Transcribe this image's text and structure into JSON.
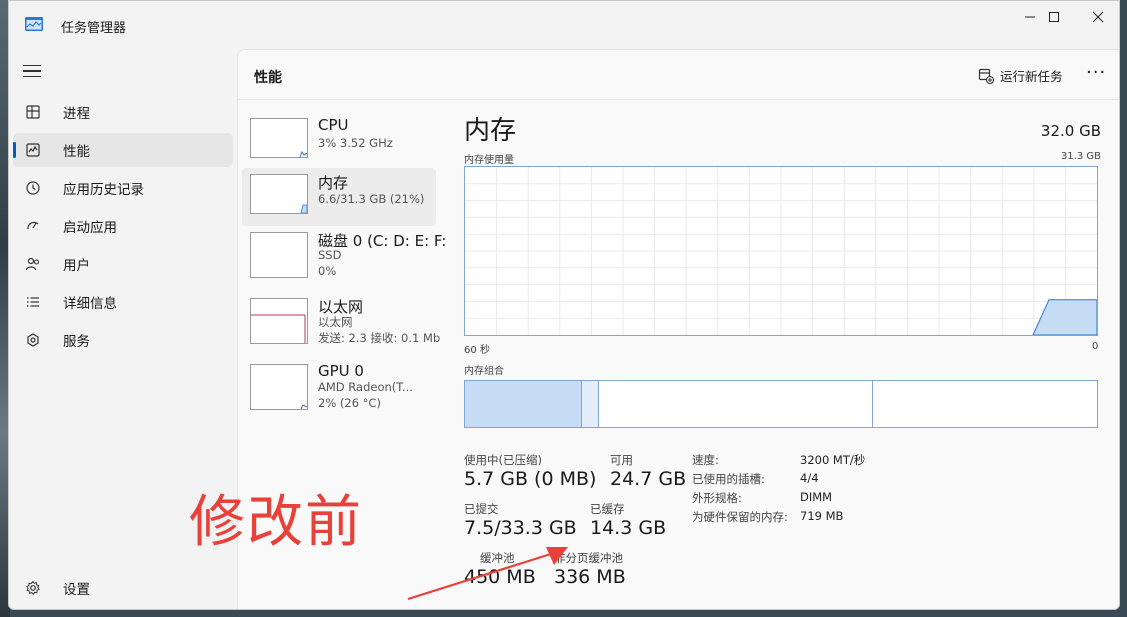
{
  "window": {
    "title": "任务管理器",
    "minimize_glyph": "—",
    "maximize_glyph": "☐",
    "close_glyph": "✕"
  },
  "sidebar": {
    "items": [
      {
        "label": "进程",
        "icon": "processes-icon"
      },
      {
        "label": "性能",
        "icon": "performance-icon",
        "active": true
      },
      {
        "label": "应用历史记录",
        "icon": "app-history-icon"
      },
      {
        "label": "启动应用",
        "icon": "startup-icon"
      },
      {
        "label": "用户",
        "icon": "users-icon"
      },
      {
        "label": "详细信息",
        "icon": "details-icon"
      },
      {
        "label": "服务",
        "icon": "services-icon"
      }
    ],
    "settings_label": "设置"
  },
  "header": {
    "title": "性能",
    "run_task_label": "运行新任务",
    "more_glyph": "···"
  },
  "devices": [
    {
      "name": "CPU",
      "lines": [
        "3% 3.52 GHz"
      ]
    },
    {
      "name": "内存",
      "lines": [
        "6.6/31.3 GB (21%)"
      ],
      "active": true
    },
    {
      "name": "磁盘 0 (C: D: E: F:",
      "lines": [
        "SSD",
        "0%"
      ]
    },
    {
      "name": "以太网",
      "lines": [
        "以太网",
        "发送: 2.3 接收: 0.1 Mb"
      ]
    },
    {
      "name": "GPU 0",
      "lines": [
        "AMD Radeon(T...",
        "2% (26 °C)"
      ]
    }
  ],
  "memory": {
    "title": "内存",
    "total": "32.0 GB",
    "usage_label": "内存使用量",
    "usage_max": "31.3 GB",
    "time_left": "60 秒",
    "time_right": "0",
    "usage_fraction": 0.21,
    "composition_label": "内存组合",
    "stats": {
      "in_use_label": "使用中(已压缩)",
      "in_use_value": "5.7 GB (0 MB)",
      "available_label": "可用",
      "available_value": "24.7 GB",
      "committed_label": "已提交",
      "committed_value": "7.5/33.3 GB",
      "cached_label": "已缓存",
      "cached_value": "14.3 GB",
      "paged_label": "分页缓冲池",
      "paged_label_visible": "缓冲池",
      "paged_value": "450 MB",
      "nonpaged_label": "非分页缓冲池",
      "nonpaged_value": "336 MB"
    },
    "props": [
      {
        "label": "速度:",
        "value": "3200 MT/秒"
      },
      {
        "label": "已使用的插槽:",
        "value": "4/4"
      },
      {
        "label": "外形规格:",
        "value": "DIMM"
      },
      {
        "label": "为硬件保留的内存:",
        "value": "719 MB"
      }
    ]
  },
  "annotation": {
    "text": "修改前",
    "color": "#e8413a"
  },
  "colors": {
    "accent": "#005fb8",
    "graph_border": "#7fa6d4",
    "graph_fill": "#c6dcf5"
  }
}
